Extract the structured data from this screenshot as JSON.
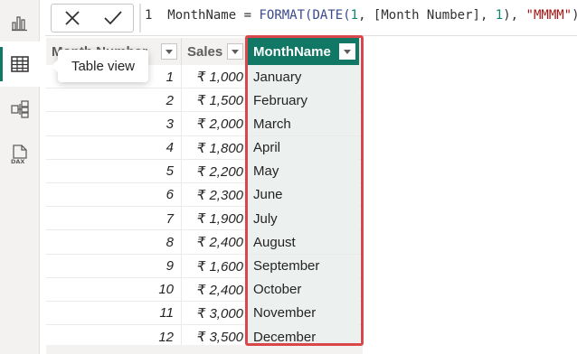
{
  "formula_bar": {
    "line_number": "1",
    "measure": "MonthName",
    "operator": "=",
    "function_format": "FORMAT(",
    "function_date": "DATE(",
    "arg_one": "1",
    "arg_column": ", [Month Number], ",
    "arg_day": "1",
    "close_paren": "), ",
    "format_string": "\"MMMM\"",
    "end_paren": ")"
  },
  "tooltip": {
    "label": "Table view"
  },
  "grid": {
    "columns": [
      "Month Number",
      "Sales",
      "MonthName"
    ],
    "rows": [
      {
        "month_number": "1",
        "sales": "₹ 1,000",
        "month_name": "January"
      },
      {
        "month_number": "2",
        "sales": "₹ 1,500",
        "month_name": "February"
      },
      {
        "month_number": "3",
        "sales": "₹ 2,000",
        "month_name": "March"
      },
      {
        "month_number": "4",
        "sales": "₹ 1,800",
        "month_name": "April"
      },
      {
        "month_number": "5",
        "sales": "₹ 2,200",
        "month_name": "May"
      },
      {
        "month_number": "6",
        "sales": "₹ 2,300",
        "month_name": "June"
      },
      {
        "month_number": "7",
        "sales": "₹ 1,900",
        "month_name": "July"
      },
      {
        "month_number": "8",
        "sales": "₹ 2,400",
        "month_name": "August"
      },
      {
        "month_number": "9",
        "sales": "₹ 1,600",
        "month_name": "September"
      },
      {
        "month_number": "10",
        "sales": "₹ 2,400",
        "month_name": "October"
      },
      {
        "month_number": "11",
        "sales": "₹ 3,000",
        "month_name": "November"
      },
      {
        "month_number": "12",
        "sales": "₹ 3,500",
        "month_name": "December"
      }
    ]
  },
  "colors": {
    "accent": "#117865",
    "highlight": "#d9474b"
  },
  "icons": [
    "report-view-icon",
    "table-view-icon",
    "model-view-icon",
    "dax-query-icon",
    "cancel-icon",
    "commit-icon",
    "filter-dropdown-icon"
  ]
}
